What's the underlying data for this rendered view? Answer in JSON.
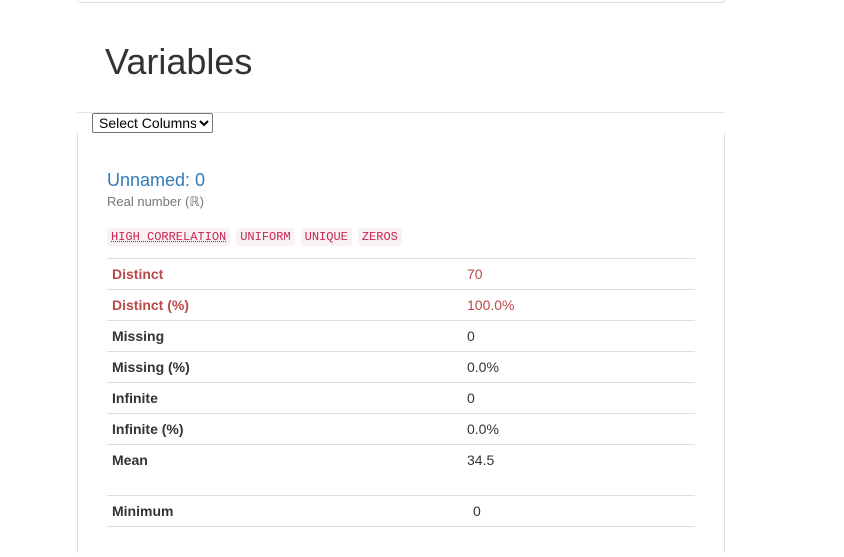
{
  "section": {
    "title": "Variables"
  },
  "column_selector": {
    "selected": "Select Columns",
    "options": [
      "Select Columns"
    ]
  },
  "variable": {
    "name": "Unnamed: 0",
    "type": "Real number (ℝ)",
    "badges": [
      "HIGH CORRELATION",
      "UNIFORM",
      "UNIQUE",
      "ZEROS"
    ],
    "stats": [
      {
        "label": "Distinct",
        "value": "70",
        "alert": true
      },
      {
        "label": "Distinct (%)",
        "value": "100.0%",
        "alert": true
      },
      {
        "label": "Missing",
        "value": "0",
        "alert": false
      },
      {
        "label": "Missing (%)",
        "value": "0.0%",
        "alert": false
      },
      {
        "label": "Infinite",
        "value": "0",
        "alert": false
      },
      {
        "label": "Infinite (%)",
        "value": "0.0%",
        "alert": false
      },
      {
        "label": "Mean",
        "value": "34.5",
        "alert": false
      }
    ],
    "quantile_stats": [
      {
        "label": "Minimum",
        "value": "0"
      }
    ]
  }
}
